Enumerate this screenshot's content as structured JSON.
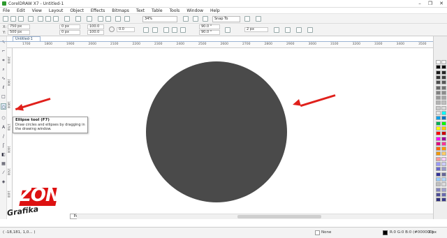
{
  "window": {
    "title": "CorelDRAW X7 - Untitled-1",
    "minimize": "–",
    "restore": "❐",
    "close": "✕"
  },
  "menu": [
    "File",
    "Edit",
    "View",
    "Layout",
    "Object",
    "Effects",
    "Bitmaps",
    "Text",
    "Table",
    "Tools",
    "Window",
    "Help"
  ],
  "toolbar": {
    "zoom_value": "34%",
    "snap_label": "Snap To"
  },
  "propbar": {
    "x": "750 px",
    "y": "500 px",
    "w": "0 px",
    "h": "0 px",
    "rotation": "0.0",
    "start_angle": "90.0 °",
    "end_angle": "90.0 °",
    "outline_width": "2 px",
    "scale_x": "100.0",
    "scale_y": "100.0"
  },
  "document_tab": "Untitled-1",
  "ruler_ticks": [
    "1700",
    "1800",
    "1900",
    "2000",
    "2100",
    "2200",
    "2300",
    "2400",
    "2500",
    "2600",
    "2700",
    "2800",
    "2900",
    "3000",
    "3100",
    "3200",
    "3300",
    "3400",
    "3500"
  ],
  "vruler_ticks": [
    "2000",
    "1900",
    "1800",
    "1700",
    "1600",
    "1500",
    "1400"
  ],
  "tooltip": {
    "title": "Ellipse tool (F7)",
    "desc": "Draw circles and ellipses by dragging in the drawing window."
  },
  "page_tab": "Page 1",
  "status": {
    "coords": "( -18,181, 1,0... )",
    "fill": "None",
    "color": "R:0 G:0 B:0 (#000000)",
    "stroke": "2 px"
  },
  "logo": {
    "word": "ZONA",
    "sub": "Grafika"
  },
  "colors": {
    "circle": "#4a4a4a",
    "arrow": "#e0201b",
    "accent": "#d11111"
  },
  "palette": {
    "col1": [
      "#ffffff",
      "#000000",
      "#1a1a1a",
      "#333333",
      "#4d4d4d",
      "#666666",
      "#808080",
      "#999999",
      "#b3b3b3",
      "#cccccc",
      "#e6e6e6",
      "#00a0e9",
      "#00b050",
      "#ffff00",
      "#ff0000",
      "#ff00ff",
      "#e4007f",
      "#ff6600",
      "#f39800",
      "#ff9999",
      "#9999ff",
      "#6666cc",
      "#333399",
      "#99ccff",
      "#c0c0c0",
      "#7f7fbf",
      "#4d4d99",
      "#2e2e7a"
    ],
    "col2": [
      "#f2f2f2",
      "#0d0d0d",
      "#262626",
      "#404040",
      "#595959",
      "#737373",
      "#8c8c8c",
      "#a6a6a6",
      "#bfbfbf",
      "#d9d9d9",
      "#00ffff",
      "#0070c0",
      "#00ff00",
      "#ffcc00",
      "#cc0000",
      "#990099",
      "#ff3399",
      "#ff9900",
      "#ffcc66",
      "#ffccff",
      "#ccccff",
      "#9999cc",
      "#666699",
      "#b3d9ff",
      "#dddddd",
      "#a0a0d0",
      "#6a6ab0",
      "#3a3a8a"
    ]
  }
}
